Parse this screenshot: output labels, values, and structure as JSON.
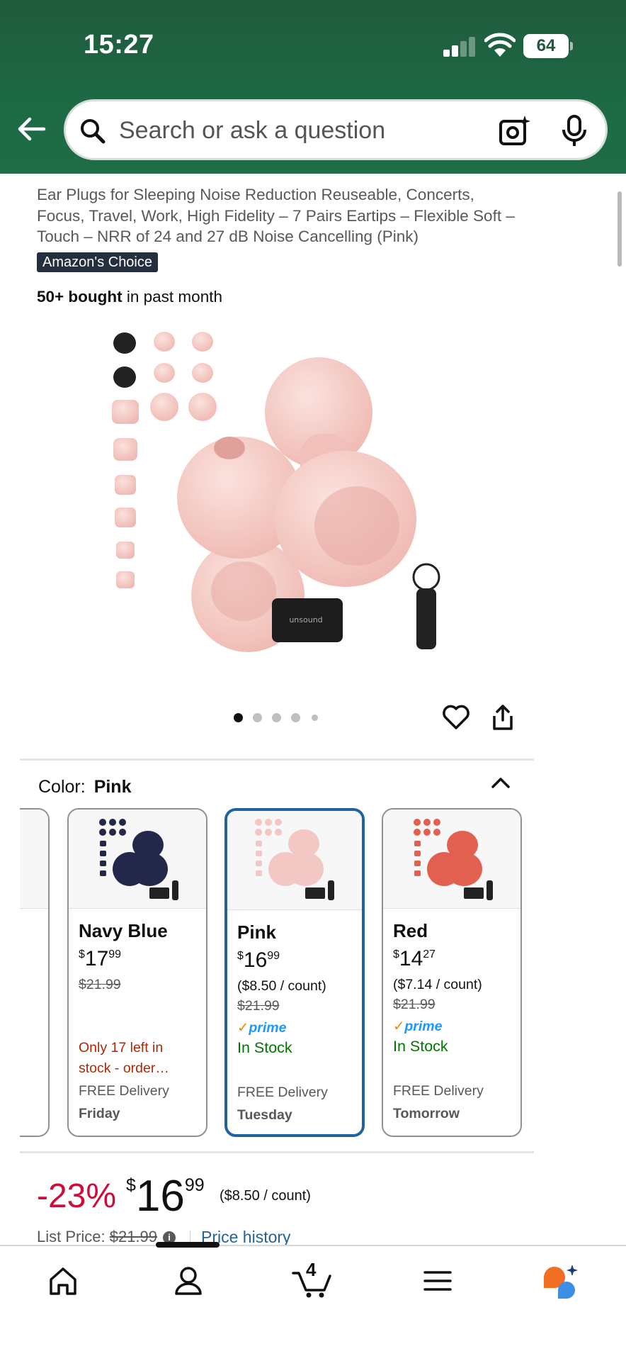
{
  "status": {
    "time": "15:27",
    "battery": "64"
  },
  "search": {
    "placeholder": "Search or ask a question"
  },
  "product": {
    "title": "Ear Plugs for Sleeping Noise Reduction Reuseable, Concerts, Focus, Travel, Work, High Fidelity – 7 Pairs Eartips – Flexible Soft – Touch – NRR of 24 and 27 dB Noise Cancelling (Pink)",
    "badge": "Amazon's Choice",
    "bought_bold": "50+ bought",
    "bought_rest": " in past month",
    "image_brand": "unsound",
    "carousel_count": 5,
    "carousel_active": 0
  },
  "color": {
    "label": "Color:",
    "selected": "Pink",
    "options": [
      {
        "name": "Navy Blue",
        "dollars": "17",
        "cents": "99",
        "unit": "",
        "list": "$21.99",
        "prime": "",
        "stock": "Only 17 left in stock - order…",
        "delivery": "FREE Delivery",
        "day": "Friday",
        "color": "#23284a"
      },
      {
        "name": "Pink",
        "dollars": "16",
        "cents": "99",
        "unit": "($8.50 / count)",
        "list": "$21.99",
        "prime": "prime",
        "stock": "In Stock",
        "delivery": "FREE Delivery",
        "day": "Tuesday",
        "color": "#f3c8c4"
      },
      {
        "name": "Red",
        "dollars": "14",
        "cents": "27",
        "unit": "($7.14 / count)",
        "list": "$21.99",
        "prime": "prime",
        "stock": "In Stock",
        "delivery": "FREE Delivery",
        "day": "Tomorrow",
        "color": "#e2604f"
      }
    ]
  },
  "price": {
    "discount": "-23%",
    "symbol": "$",
    "dollars": "16",
    "cents": "99",
    "unit": "($8.50 / count)",
    "list_label": "List Price:",
    "list_value": "$21.99",
    "history_link": "Price history"
  },
  "nav": {
    "cart_count": "4"
  },
  "colors": {
    "header": "#1f5a3c",
    "accent_blue": "#2162a1",
    "discount_red": "#cc0c39",
    "stock_green": "#007600"
  }
}
